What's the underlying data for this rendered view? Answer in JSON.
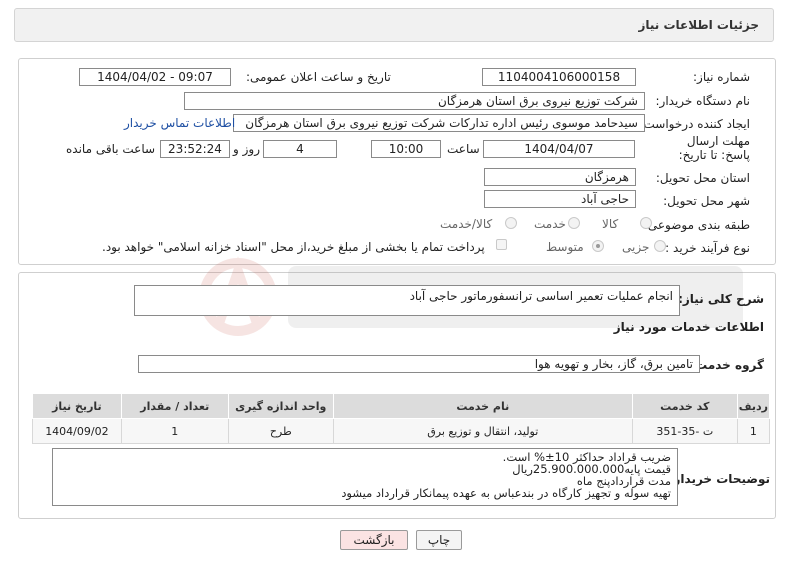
{
  "header": {
    "title": "جزئیات اطلاعات نیاز"
  },
  "labels": {
    "need_number": "شماره نیاز:",
    "announce_datetime": "تاریخ و ساعت اعلان عمومی:",
    "buyer_org": "نام دستگاه خریدار:",
    "requester": "ایجاد کننده درخواست:",
    "deadline": "مهلت ارسال پاسخ: تا تاریخ:",
    "time_word": "ساعت",
    "days_word": "روز و",
    "remaining_word": "ساعت باقی مانده",
    "province": "استان محل تحویل:",
    "city": "شهر محل تحویل:",
    "category": "طبقه بندی موضوعی:",
    "purchase_type": "نوع فرآیند خرید :",
    "need_summary": "شرح کلی نیاز:",
    "services_info": "اطلاعات خدمات مورد نیاز",
    "service_group": "گروه خدمت:",
    "buyer_notes": "توضیحات خریدار:"
  },
  "fields": {
    "need_number": "1104004106000158",
    "announce_datetime": "1404/04/02 - 09:07",
    "buyer_org": "شرکت توزیع نیروی برق استان هرمزگان",
    "requester": "سیدحامد موسوی رئیس اداره تدارکات شرکت توزیع نیروی برق استان هرمزگان",
    "contact_link": "اطلاعات تماس خریدار",
    "deadline_date": "1404/04/07",
    "deadline_time": "10:00",
    "remaining_days": "4",
    "remaining_time": "23:52:24",
    "province": "هرمزگان",
    "city": "حاجی آباد",
    "need_summary": "انجام عملیات تعمیر اساسی ترانسفورماتور حاجی آباد",
    "service_group": "تامین برق، گاز، بخار و تهویه هوا"
  },
  "category_options": [
    {
      "label": "کالا",
      "selected": false
    },
    {
      "label": "خدمت",
      "selected": false
    },
    {
      "label": "کالا/خدمت",
      "selected": false
    }
  ],
  "purchase_options": [
    {
      "label": "جزیی",
      "selected": false
    },
    {
      "label": "متوسط",
      "selected": true
    }
  ],
  "treasury_note": "پرداخت تمام یا بخشی از مبلغ خرید،از محل \"اسناد خزانه اسلامی\" خواهد بود.",
  "table": {
    "headers": [
      "ردیف",
      "کد خدمت",
      "نام خدمت",
      "واحد اندازه گیری",
      "تعداد / مقدار",
      "تاریخ نیاز"
    ],
    "rows": [
      [
        "1",
        "ت -35-351",
        "تولید، انتقال و توزیع برق",
        "طرح",
        "1",
        "1404/09/02"
      ]
    ]
  },
  "buyer_notes_lines": [
    "ضریب قراداد حداکثر 10±% است.",
    "قیمت پایه25.900.000.000ریال",
    "مدت قراردادپنج  ماه",
    "تهیه سوله و تجهیز کارگاه در بندعباس به عهده  پیمانکار قرارداد میشود"
  ],
  "buttons": {
    "print": "چاپ",
    "back": "بازگشت"
  },
  "colors": {
    "link": "#1e4fa3",
    "back_button_bg": "#fbe3e3",
    "watermark": "#c0392b"
  }
}
